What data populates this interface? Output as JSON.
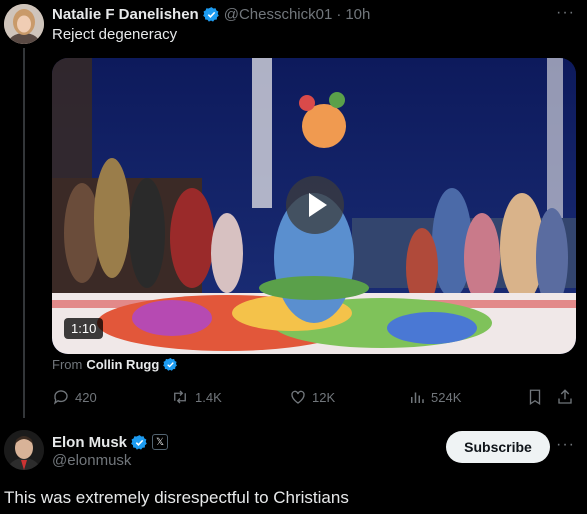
{
  "tweet1": {
    "author_name": "Natalie F Danelishen",
    "handle": "@Chesschick01",
    "separator": "·",
    "time": "10h",
    "text": "Reject degeneracy",
    "more_label": "···",
    "media": {
      "duration": "1:10",
      "from_prefix": "From",
      "from_name": "Collin Rugg"
    },
    "actions": {
      "replies": "420",
      "reposts": "1.4K",
      "likes": "12K",
      "views": "524K"
    }
  },
  "tweet2": {
    "author_name": "Elon Musk",
    "handle": "@elonmusk",
    "affiliate_badge": "𝕏",
    "subscribe_label": "Subscribe",
    "more_label": "···",
    "text": "This was extremely disrespectful to Christians"
  },
  "colors": {
    "background": "#000000",
    "text_primary": "#e7e9ea",
    "text_secondary": "#71767b",
    "verified_blue": "#1d9bf0"
  },
  "icons": [
    "verified-icon",
    "play-icon",
    "reply-icon",
    "repost-icon",
    "like-icon",
    "views-icon",
    "bookmark-icon",
    "share-icon",
    "x-affiliate-icon"
  ]
}
